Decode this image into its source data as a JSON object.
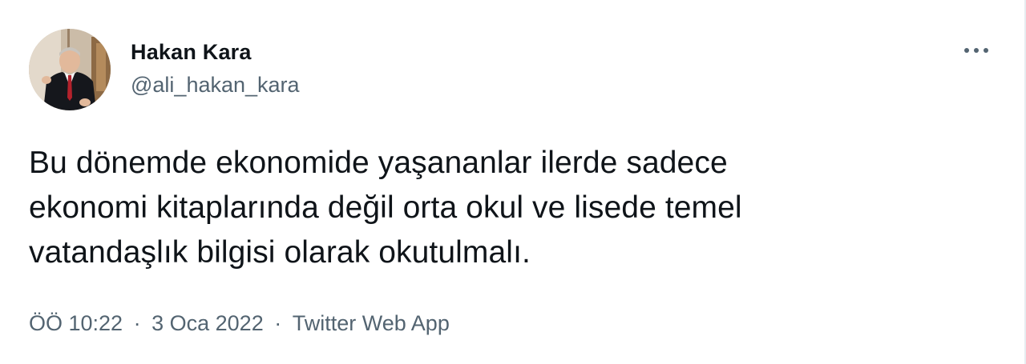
{
  "user": {
    "display_name": "Hakan Kara",
    "handle": "@ali_hakan_kara"
  },
  "more_icon": "more-horizontal-icon",
  "tweet": {
    "lines": [
      "Bu dönemde ekonomide yaşananlar ilerde sadece",
      "ekonomi kitaplarında değil orta okul ve lisede temel",
      "vatandaşlık bilgisi olarak okutulmalı."
    ]
  },
  "meta": {
    "time": "ÖÖ 10:22",
    "date": "3 Oca 2022",
    "source": "Twitter Web App",
    "separator": "·"
  },
  "colors": {
    "text": "#0f1419",
    "secondary": "#536471"
  }
}
